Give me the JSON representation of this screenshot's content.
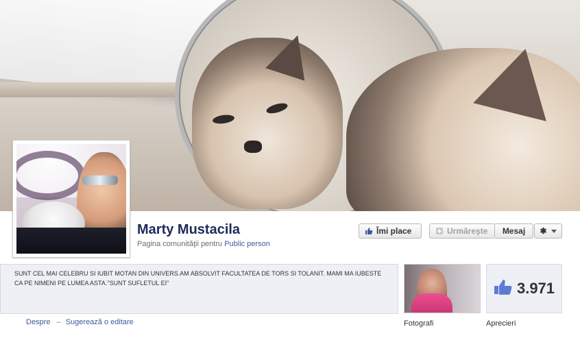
{
  "page": {
    "name": "Marty Mustacila",
    "subtitle_prefix": "Pagina comunităţii pentru",
    "category": "Public person"
  },
  "buttons": {
    "like_label": "Îmi place",
    "follow_label": "Urmăreşte",
    "message_label": "Mesaj"
  },
  "about": {
    "text": "SUNT CEL MAI CELEBRU SI IUBIT MOTAN DIN UNIVERS.AM ABSOLVIT FACULTATEA DE TORS SI TOLANIT. MAMI MA IUBESTE CA PE NIMENI PE LUMEA ASTA.\"SUNT SUFLETUL EI\""
  },
  "links": {
    "about": "Despre",
    "suggest_edit": "Sugerează o editare"
  },
  "photos": {
    "label": "Fotografi"
  },
  "likes": {
    "count": "3.971",
    "label": "Aprecieri"
  },
  "colors": {
    "facebook_blue": "#3b5998",
    "name_color": "#1d2a5b",
    "like_icon_blue": "#5b7bd5"
  },
  "icons": [
    "thumbs-up-icon",
    "follow-icon",
    "gear-icon",
    "chevron-down-icon",
    "likes-thumb-icon"
  ]
}
